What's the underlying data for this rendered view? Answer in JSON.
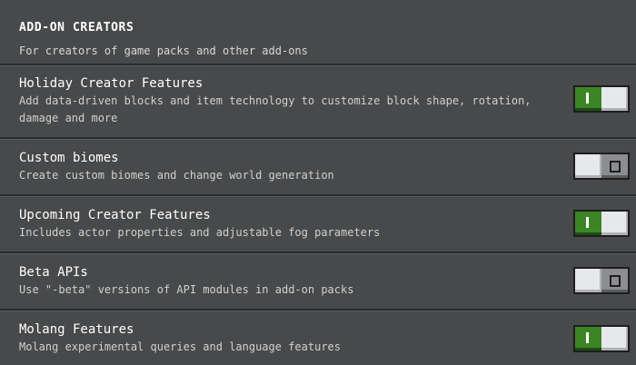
{
  "section": {
    "title": "ADD-ON CREATORS",
    "subtitle": "For creators of game packs and other add-ons"
  },
  "features": [
    {
      "title": "Holiday Creator Features",
      "description": "Add data-driven blocks and item technology to customize block shape, rotation, damage and more",
      "enabled": true
    },
    {
      "title": "Custom biomes",
      "description": "Create custom biomes and change world generation",
      "enabled": false
    },
    {
      "title": "Upcoming Creator Features",
      "description": "Includes actor properties and adjustable fog parameters",
      "enabled": true
    },
    {
      "title": "Beta APIs",
      "description": "Use \"-beta\" versions of API modules in add-on packs",
      "enabled": false
    },
    {
      "title": "Molang Features",
      "description": "Molang experimental queries and language features",
      "enabled": true
    }
  ],
  "colors": {
    "toggle_on": "#3c8527",
    "toggle_off": "#8c8d90",
    "background": "#48494a"
  },
  "icons": {
    "on_indicator": "toggle-on-bar-icon",
    "off_indicator": "toggle-off-circle-icon"
  }
}
